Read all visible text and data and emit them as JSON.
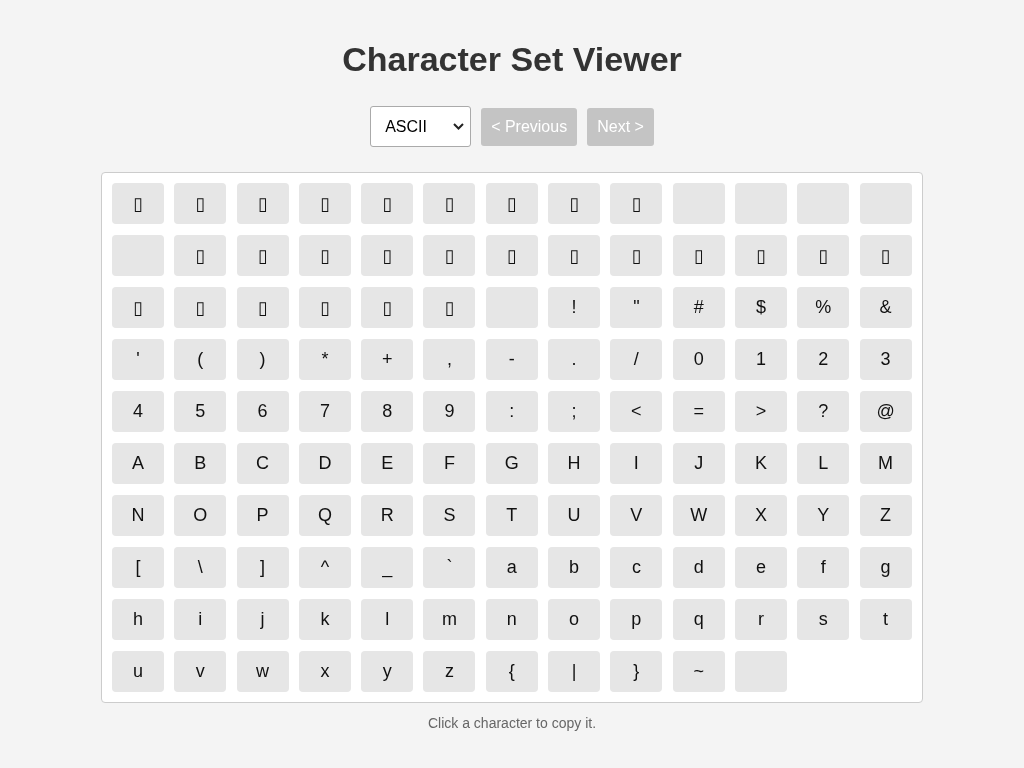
{
  "title": "Character Set Viewer",
  "controls": {
    "charset": "ASCII",
    "buttons": [
      {
        "label": "< Previous",
        "disabled": true
      },
      {
        "label": "Next >",
        "disabled": true
      }
    ]
  },
  "characters": [
    {
      "kind": "char",
      "label": "▯"
    },
    {
      "kind": "char",
      "label": "▯"
    },
    {
      "kind": "char",
      "label": "▯"
    },
    {
      "kind": "char",
      "label": "▯"
    },
    {
      "kind": "char",
      "label": "▯"
    },
    {
      "kind": "char",
      "label": "▯"
    },
    {
      "kind": "char",
      "label": "▯"
    },
    {
      "kind": "char",
      "label": "▯"
    },
    {
      "kind": "char",
      "label": "▯"
    },
    {
      "kind": "blank"
    },
    {
      "kind": "blank"
    },
    {
      "kind": "blank"
    },
    {
      "kind": "blank"
    },
    {
      "kind": "blank"
    },
    {
      "kind": "char",
      "label": "▯"
    },
    {
      "kind": "char",
      "label": "▯"
    },
    {
      "kind": "char",
      "label": "▯"
    },
    {
      "kind": "char",
      "label": "▯"
    },
    {
      "kind": "char",
      "label": "▯"
    },
    {
      "kind": "char",
      "label": "▯"
    },
    {
      "kind": "char",
      "label": "▯"
    },
    {
      "kind": "char",
      "label": "▯"
    },
    {
      "kind": "char",
      "label": "▯"
    },
    {
      "kind": "char",
      "label": "▯"
    },
    {
      "kind": "char",
      "label": "▯"
    },
    {
      "kind": "char",
      "label": "▯"
    },
    {
      "kind": "char",
      "label": "▯"
    },
    {
      "kind": "char",
      "label": "▯"
    },
    {
      "kind": "char",
      "label": "▯"
    },
    {
      "kind": "char",
      "label": "▯"
    },
    {
      "kind": "char",
      "label": "▯"
    },
    {
      "kind": "char",
      "label": "▯"
    },
    {
      "kind": "blank"
    },
    {
      "kind": "char",
      "label": "!"
    },
    {
      "kind": "char",
      "label": "\""
    },
    {
      "kind": "char",
      "label": "#"
    },
    {
      "kind": "char",
      "label": "$"
    },
    {
      "kind": "char",
      "label": "%"
    },
    {
      "kind": "char",
      "label": "&"
    },
    {
      "kind": "char",
      "label": "'"
    },
    {
      "kind": "char",
      "label": "("
    },
    {
      "kind": "char",
      "label": ")"
    },
    {
      "kind": "char",
      "label": "*"
    },
    {
      "kind": "char",
      "label": "+"
    },
    {
      "kind": "char",
      "label": ","
    },
    {
      "kind": "char",
      "label": "-"
    },
    {
      "kind": "char",
      "label": "."
    },
    {
      "kind": "char",
      "label": "/"
    },
    {
      "kind": "char",
      "label": "0"
    },
    {
      "kind": "char",
      "label": "1"
    },
    {
      "kind": "char",
      "label": "2"
    },
    {
      "kind": "char",
      "label": "3"
    },
    {
      "kind": "char",
      "label": "4"
    },
    {
      "kind": "char",
      "label": "5"
    },
    {
      "kind": "char",
      "label": "6"
    },
    {
      "kind": "char",
      "label": "7"
    },
    {
      "kind": "char",
      "label": "8"
    },
    {
      "kind": "char",
      "label": "9"
    },
    {
      "kind": "char",
      "label": ":"
    },
    {
      "kind": "char",
      "label": ";"
    },
    {
      "kind": "char",
      "label": "<"
    },
    {
      "kind": "char",
      "label": "="
    },
    {
      "kind": "char",
      "label": ">"
    },
    {
      "kind": "char",
      "label": "?"
    },
    {
      "kind": "char",
      "label": "@"
    },
    {
      "kind": "char",
      "label": "A"
    },
    {
      "kind": "char",
      "label": "B"
    },
    {
      "kind": "char",
      "label": "C"
    },
    {
      "kind": "char",
      "label": "D"
    },
    {
      "kind": "char",
      "label": "E"
    },
    {
      "kind": "char",
      "label": "F"
    },
    {
      "kind": "char",
      "label": "G"
    },
    {
      "kind": "char",
      "label": "H"
    },
    {
      "kind": "char",
      "label": "I"
    },
    {
      "kind": "char",
      "label": "J"
    },
    {
      "kind": "char",
      "label": "K"
    },
    {
      "kind": "char",
      "label": "L"
    },
    {
      "kind": "char",
      "label": "M"
    },
    {
      "kind": "char",
      "label": "N"
    },
    {
      "kind": "char",
      "label": "O"
    },
    {
      "kind": "char",
      "label": "P"
    },
    {
      "kind": "char",
      "label": "Q"
    },
    {
      "kind": "char",
      "label": "R"
    },
    {
      "kind": "char",
      "label": "S"
    },
    {
      "kind": "char",
      "label": "T"
    },
    {
      "kind": "char",
      "label": "U"
    },
    {
      "kind": "char",
      "label": "V"
    },
    {
      "kind": "char",
      "label": "W"
    },
    {
      "kind": "char",
      "label": "X"
    },
    {
      "kind": "char",
      "label": "Y"
    },
    {
      "kind": "char",
      "label": "Z"
    },
    {
      "kind": "char",
      "label": "["
    },
    {
      "kind": "char",
      "label": "\\"
    },
    {
      "kind": "char",
      "label": "]"
    },
    {
      "kind": "char",
      "label": "^"
    },
    {
      "kind": "char",
      "label": "_"
    },
    {
      "kind": "char",
      "label": "`"
    },
    {
      "kind": "char",
      "label": "a"
    },
    {
      "kind": "char",
      "label": "b"
    },
    {
      "kind": "char",
      "label": "c"
    },
    {
      "kind": "char",
      "label": "d"
    },
    {
      "kind": "char",
      "label": "e"
    },
    {
      "kind": "char",
      "label": "f"
    },
    {
      "kind": "char",
      "label": "g"
    },
    {
      "kind": "char",
      "label": "h"
    },
    {
      "kind": "char",
      "label": "i"
    },
    {
      "kind": "char",
      "label": "j"
    },
    {
      "kind": "char",
      "label": "k"
    },
    {
      "kind": "char",
      "label": "l"
    },
    {
      "kind": "char",
      "label": "m"
    },
    {
      "kind": "char",
      "label": "n"
    },
    {
      "kind": "char",
      "label": "o"
    },
    {
      "kind": "char",
      "label": "p"
    },
    {
      "kind": "char",
      "label": "q"
    },
    {
      "kind": "char",
      "label": "r"
    },
    {
      "kind": "char",
      "label": "s"
    },
    {
      "kind": "char",
      "label": "t"
    },
    {
      "kind": "char",
      "label": "u"
    },
    {
      "kind": "char",
      "label": "v"
    },
    {
      "kind": "char",
      "label": "w"
    },
    {
      "kind": "char",
      "label": "x"
    },
    {
      "kind": "char",
      "label": "y"
    },
    {
      "kind": "char",
      "label": "z"
    },
    {
      "kind": "char",
      "label": "{"
    },
    {
      "kind": "char",
      "label": "|"
    },
    {
      "kind": "char",
      "label": "}"
    },
    {
      "kind": "char",
      "label": "~"
    },
    {
      "kind": "blank"
    }
  ],
  "hint": "Click a character to copy it."
}
